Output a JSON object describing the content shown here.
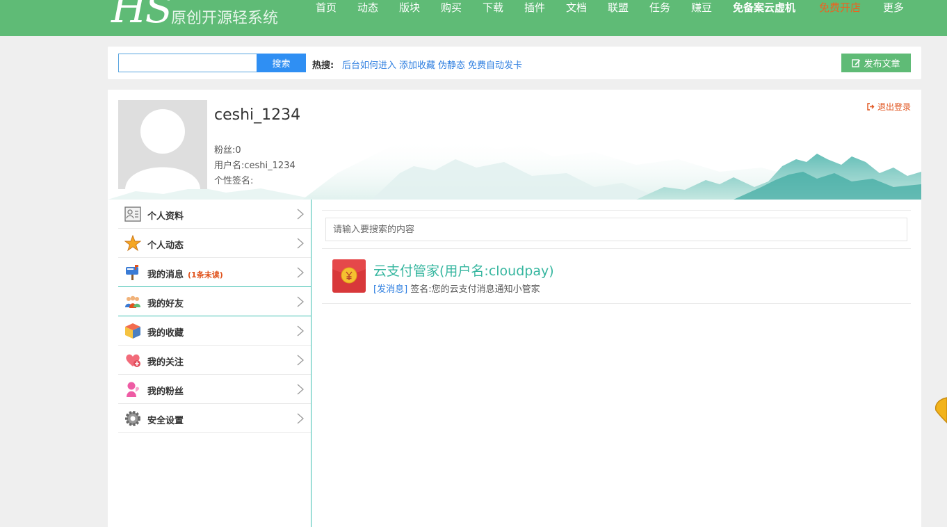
{
  "header": {
    "logo_mark": "HS",
    "logo_text": "原创开源轻系统",
    "nav": [
      {
        "label": "首页"
      },
      {
        "label": "动态"
      },
      {
        "label": "版块"
      },
      {
        "label": "购买"
      },
      {
        "label": "下载"
      },
      {
        "label": "插件"
      },
      {
        "label": "文档"
      },
      {
        "label": "联盟"
      },
      {
        "label": "任务"
      },
      {
        "label": "赚豆"
      },
      {
        "label": "免备案云虚机"
      },
      {
        "label": "免费开店"
      },
      {
        "label": "更多"
      }
    ],
    "colors": {
      "bar": "#5fbb76",
      "highlight": "#f0601e"
    }
  },
  "search": {
    "value": "",
    "button": "搜索",
    "hot_label": "热搜:",
    "hot_links": [
      "后台如何进入",
      "添加收藏",
      "伪静态",
      "免费自动发卡"
    ],
    "publish_button": "发布文章",
    "publish_icon": "edit-icon"
  },
  "profile": {
    "username_display": "ceshi_1234",
    "fans": "粉丝:0",
    "username_line": "用户名:ceshi_1234",
    "signature": "个性签名:",
    "logout": "退出登录",
    "logout_icon": "sign-out-icon"
  },
  "menu": {
    "items": [
      {
        "label": "个人资料",
        "icon": "profile-card-icon"
      },
      {
        "label": "个人动态",
        "icon": "star-icon"
      },
      {
        "label": "我的消息",
        "badge": "(1条未读)",
        "icon": "mailbox-icon"
      },
      {
        "label": "我的好友",
        "icon": "friends-icon"
      },
      {
        "label": "我的收藏",
        "icon": "cube-icon"
      },
      {
        "label": "我的关注",
        "icon": "heart-plus-icon"
      },
      {
        "label": "我的粉丝",
        "icon": "fan-icon"
      },
      {
        "label": "安全设置",
        "icon": "gear-icon"
      }
    ]
  },
  "content": {
    "search_placeholder": "请输入要搜索的内容",
    "messages": [
      {
        "title": "云支付管家(用户名:cloudpay)",
        "tag": "[发消息]",
        "signature": "签名:您的云支付消息通知小管家",
        "icon": "red-envelope-icon"
      }
    ]
  }
}
